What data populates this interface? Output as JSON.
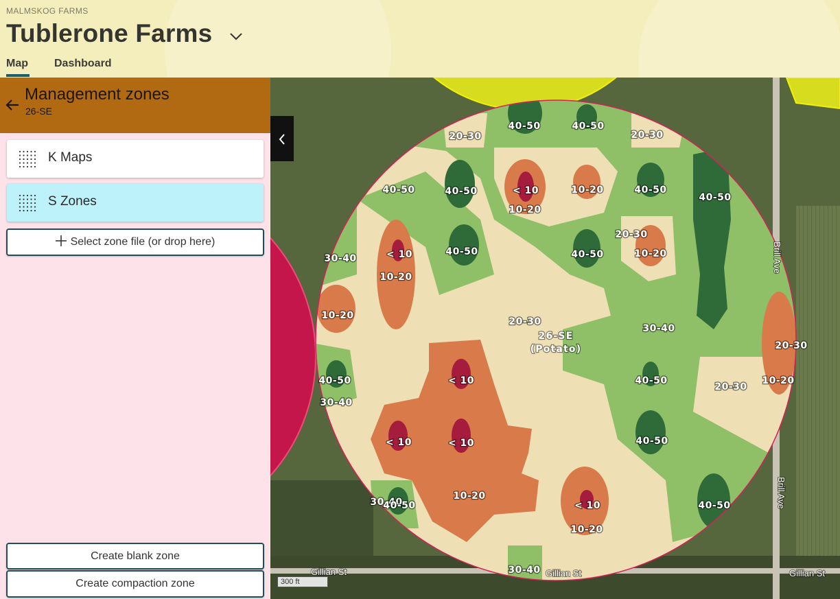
{
  "header": {
    "org": "MALMSKOG FARMS",
    "farm": "Tublerone Farms",
    "tabs": [
      {
        "label": "Map",
        "active": true
      },
      {
        "label": "Dashboard",
        "active": false
      }
    ]
  },
  "panel": {
    "title": "Management zones",
    "subtitle": "26-SE",
    "layers": [
      {
        "label": "K Maps",
        "selected": false,
        "icon": "dot-grid-icon"
      },
      {
        "label": "S Zones",
        "selected": true,
        "icon": "dot-grid-icon"
      }
    ],
    "select_file": "Select zone file (or drop here)",
    "create_blank": "Create blank zone",
    "create_compaction": "Create compaction zone"
  },
  "map": {
    "field_name": "26-SE",
    "field_crop": "(Potato)",
    "streets": [
      "Gillian St",
      "Gillian St",
      "Gillian St",
      "Brill Ave",
      "Brill Ave"
    ],
    "scale": "300 ft",
    "zone_labels": [
      "40-50",
      "40-50",
      "20-30",
      "20-30",
      "40-50",
      "40-50",
      "< 10",
      "10-20",
      "10-20",
      "40-50",
      "40-50",
      "30-40",
      "< 10",
      "10-20",
      "40-50",
      "40-50",
      "20-30",
      "10-20",
      "10-20",
      "20-30",
      "30-40",
      "20-30",
      "40-50",
      "< 10",
      "40-50",
      "10-20",
      "30-40",
      "20-30",
      "< 10",
      "< 10",
      "40-50",
      "10-20",
      "30-40",
      "40-50",
      "< 10",
      "10-20",
      "40-50",
      "30-40"
    ],
    "colors": {
      "lt10": "#a51c3c",
      "r10_20": "#d97a4a",
      "r20_30": "#eedfb4",
      "r30_40": "#8fc068",
      "r40_50": "#2f6b38",
      "boundary": "#d6205a",
      "neighbor_yellow": "#dfe300"
    }
  }
}
